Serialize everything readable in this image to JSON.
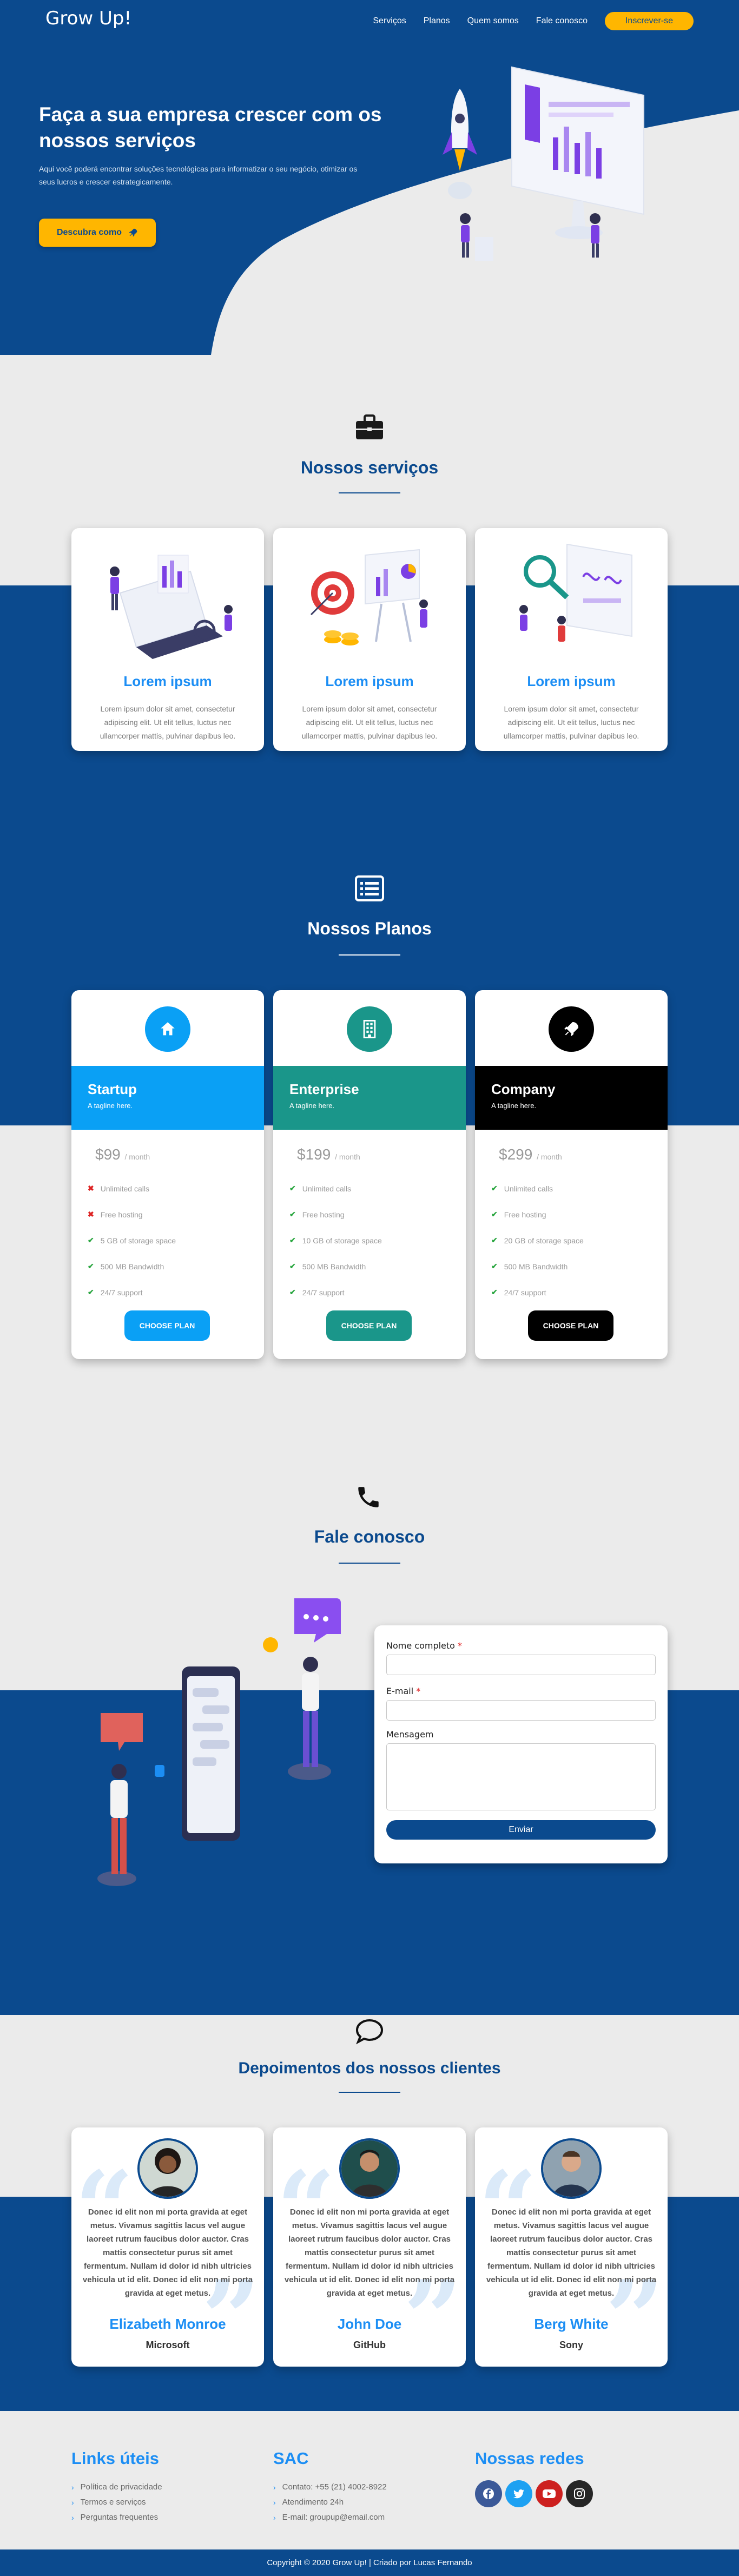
{
  "nav": {
    "brand": "Grow Up!",
    "links": [
      "Serviços",
      "Planos",
      "Quem somos",
      "Fale conosco"
    ],
    "cta": "Inscrever-se"
  },
  "hero": {
    "title": "Faça a sua empresa crescer com os nossos serviços",
    "subtitle": "Aqui você poderá encontrar soluções tecnológicas para informatizar o seu negócio, otimizar os seus lucros e crescer estrategicamente.",
    "button": "Descubra como"
  },
  "services": {
    "title": "Nossos serviços",
    "cards": [
      {
        "title": "Lorem ipsum",
        "text": "Lorem ipsum dolor sit amet, consectetur adipiscing elit. Ut elit tellus, luctus nec ullamcorper mattis, pulvinar dapibus leo."
      },
      {
        "title": "Lorem ipsum",
        "text": "Lorem ipsum dolor sit amet, consectetur adipiscing elit. Ut elit tellus, luctus nec ullamcorper mattis, pulvinar dapibus leo."
      },
      {
        "title": "Lorem ipsum",
        "text": "Lorem ipsum dolor sit amet, consectetur adipiscing elit. Ut elit tellus, luctus nec ullamcorper mattis, pulvinar dapibus leo."
      }
    ]
  },
  "plans": {
    "title": "Nossos Planos",
    "cards": [
      {
        "name": "Startup",
        "tagline": "A tagline here.",
        "price": "$99",
        "period": "/ month",
        "color": "#0aa0f5",
        "features": [
          {
            "text": "Unlimited calls",
            "ok": false
          },
          {
            "text": "Free hosting",
            "ok": false
          },
          {
            "text": "5 GB of storage space",
            "ok": true
          },
          {
            "text": "500 MB Bandwidth",
            "ok": true
          },
          {
            "text": "24/7 support",
            "ok": true
          }
        ],
        "button": "CHOOSE PLAN"
      },
      {
        "name": "Enterprise",
        "tagline": "A tagline here.",
        "price": "$199",
        "period": "/ month",
        "color": "#1a968a",
        "features": [
          {
            "text": "Unlimited calls",
            "ok": true
          },
          {
            "text": "Free hosting",
            "ok": true
          },
          {
            "text": "10 GB of storage space",
            "ok": true
          },
          {
            "text": "500 MB Bandwidth",
            "ok": true
          },
          {
            "text": "24/7 support",
            "ok": true
          }
        ],
        "button": "CHOOSE PLAN"
      },
      {
        "name": "Company",
        "tagline": "A tagline here.",
        "price": "$299",
        "period": "/ month",
        "color": "#000000",
        "features": [
          {
            "text": "Unlimited calls",
            "ok": true
          },
          {
            "text": "Free hosting",
            "ok": true
          },
          {
            "text": "20 GB of storage space",
            "ok": true
          },
          {
            "text": "500 MB Bandwidth",
            "ok": true
          },
          {
            "text": "24/7 support",
            "ok": true
          }
        ],
        "button": "CHOOSE PLAN"
      }
    ]
  },
  "contact": {
    "title": "Fale conosco",
    "name_label": "Nome completo",
    "email_label": "E-mail",
    "message_label": "Mensagem",
    "required_mark": "*",
    "submit": "Enviar"
  },
  "testimonials": {
    "title": "Depoimentos dos nossos clientes",
    "cards": [
      {
        "text": "Donec id elit non mi porta gravida at eget metus. Vivamus sagittis lacus vel augue laoreet rutrum faucibus dolor auctor. Cras mattis consectetur purus sit amet fermentum. Nullam id dolor id nibh ultricies vehicula ut id elit. Donec id elit non mi porta gravida at eget metus.",
        "name": "Elizabeth Monroe",
        "company": "Microsoft"
      },
      {
        "text": "Donec id elit non mi porta gravida at eget metus. Vivamus sagittis lacus vel augue laoreet rutrum faucibus dolor auctor. Cras mattis consectetur purus sit amet fermentum. Nullam id dolor id nibh ultricies vehicula ut id elit. Donec id elit non mi porta gravida at eget metus.",
        "name": "John Doe",
        "company": "GitHub"
      },
      {
        "text": "Donec id elit non mi porta gravida at eget metus. Vivamus sagittis lacus vel augue laoreet rutrum faucibus dolor auctor. Cras mattis consectetur purus sit amet fermentum. Nullam id dolor id nibh ultricies vehicula ut id elit. Donec id elit non mi porta gravida at eget metus.",
        "name": "Berg White",
        "company": "Sony"
      }
    ]
  },
  "footer": {
    "links_title": "Links úteis",
    "links": [
      "Política de privacidade",
      "Termos e serviços",
      "Perguntas frequentes"
    ],
    "sac_title": "SAC",
    "sac": [
      "Contato: +55 (21) 4002-8922",
      "Atendimento 24h",
      "E-mail: groupup@email.com"
    ],
    "social_title": "Nossas redes",
    "social": [
      {
        "icon": "facebook-icon",
        "color": "#3b5998"
      },
      {
        "icon": "twitter-icon",
        "color": "#1da1f2"
      },
      {
        "icon": "youtube-icon",
        "color": "#cd201f"
      },
      {
        "icon": "instagram-icon",
        "color": "#262626"
      }
    ],
    "copyright": "Copyright © 2020 Grow Up! | Criado por Lucas Fernando"
  },
  "colors": {
    "primary": "#0b4a8e",
    "accent": "#ffb600",
    "link": "#1c8ef4",
    "background": "#ebebeb"
  }
}
